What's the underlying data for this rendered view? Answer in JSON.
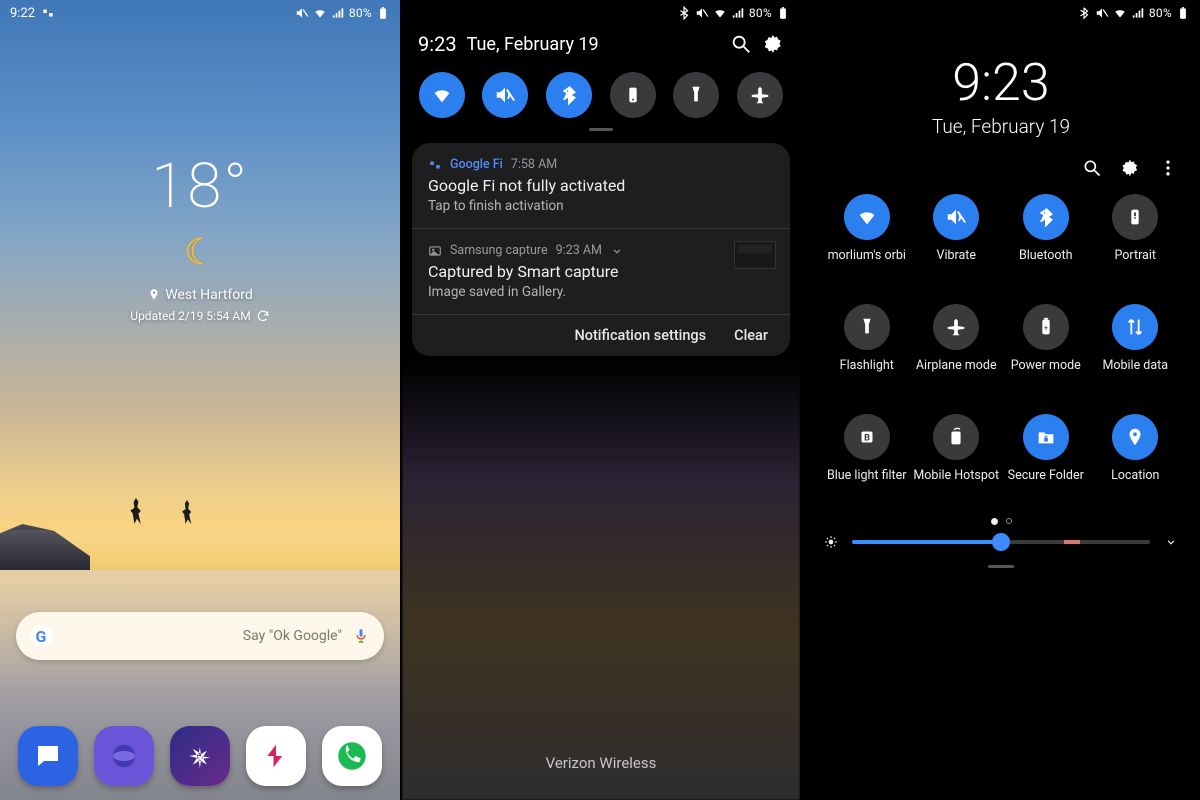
{
  "statusbar": {
    "p1_time": "9:22",
    "p23_batt": "80%"
  },
  "home": {
    "temperature": "18°",
    "location": "West Hartford",
    "updated": "Updated 2/19 5:54 AM",
    "search_hint": "Say \"Ok Google\""
  },
  "shade": {
    "time": "9:23",
    "date": "Tue, February 19",
    "notif1": {
      "app": "Google Fi",
      "when": "7:58 AM",
      "title": "Google Fi not fully activated",
      "body": "Tap to finish activation"
    },
    "notif2": {
      "app": "Samsung capture",
      "when": "9:23 AM",
      "title": "Captured by Smart capture",
      "body": "Image saved in Gallery."
    },
    "action_settings": "Notification settings",
    "action_clear": "Clear",
    "carrier": "Verizon Wireless"
  },
  "qs": {
    "time": "9:23",
    "date": "Tue, February 19",
    "tiles": {
      "wifi": "morlium's orbi",
      "vibrate": "Vibrate",
      "bt": "Bluetooth",
      "portrait": "Portrait",
      "flash": "Flashlight",
      "airplane": "Airplane mode",
      "power": "Power mode",
      "mdata": "Mobile data",
      "blf": "Blue light filter",
      "hotspot": "Mobile Hotspot",
      "secure": "Secure Folder",
      "loc": "Location"
    }
  }
}
